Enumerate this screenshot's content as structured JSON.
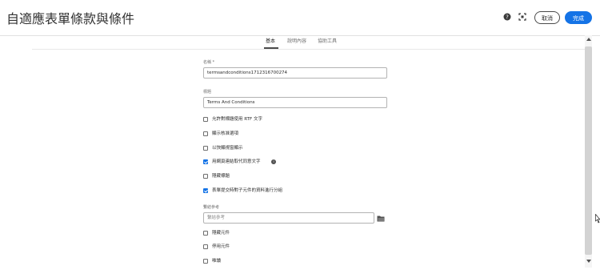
{
  "header": {
    "title": "自適應表單條款與條件",
    "cancel_label": "取消",
    "done_label": "完成",
    "icons": [
      "help-icon",
      "fullscreen-icon"
    ],
    "accent_color": "#1473e6"
  },
  "tabs": [
    {
      "label": "基本",
      "active": true
    },
    {
      "label": "說明內容",
      "active": false
    },
    {
      "label": "協助工具",
      "active": false
    }
  ],
  "fields": {
    "name_label": "名稱 *",
    "name_value": "termsandconditions1712316700274",
    "title_label": "標題",
    "title_value": "Terms And Conditions",
    "bind_ref_label": "繫結參考",
    "bind_ref_placeholder": "繫結參考"
  },
  "checkboxes": [
    {
      "label": "允許對標題使用  RTF  文字",
      "checked": false
    },
    {
      "label": "顯示核准選項",
      "checked": false
    },
    {
      "label": "以快顯視窗顯示",
      "checked": false
    },
    {
      "label": "用網頁連結取代同意文字",
      "checked": true
    },
    {
      "label": "隱藏標題",
      "checked": false
    },
    {
      "label": "表單提交時對子元件的資料進行分組",
      "checked": true
    }
  ],
  "bottom_checkboxes": [
    {
      "label": "隱藏元件",
      "checked": false
    },
    {
      "label": "停用元件",
      "checked": false
    },
    {
      "label": "唯讀",
      "checked": false
    }
  ]
}
